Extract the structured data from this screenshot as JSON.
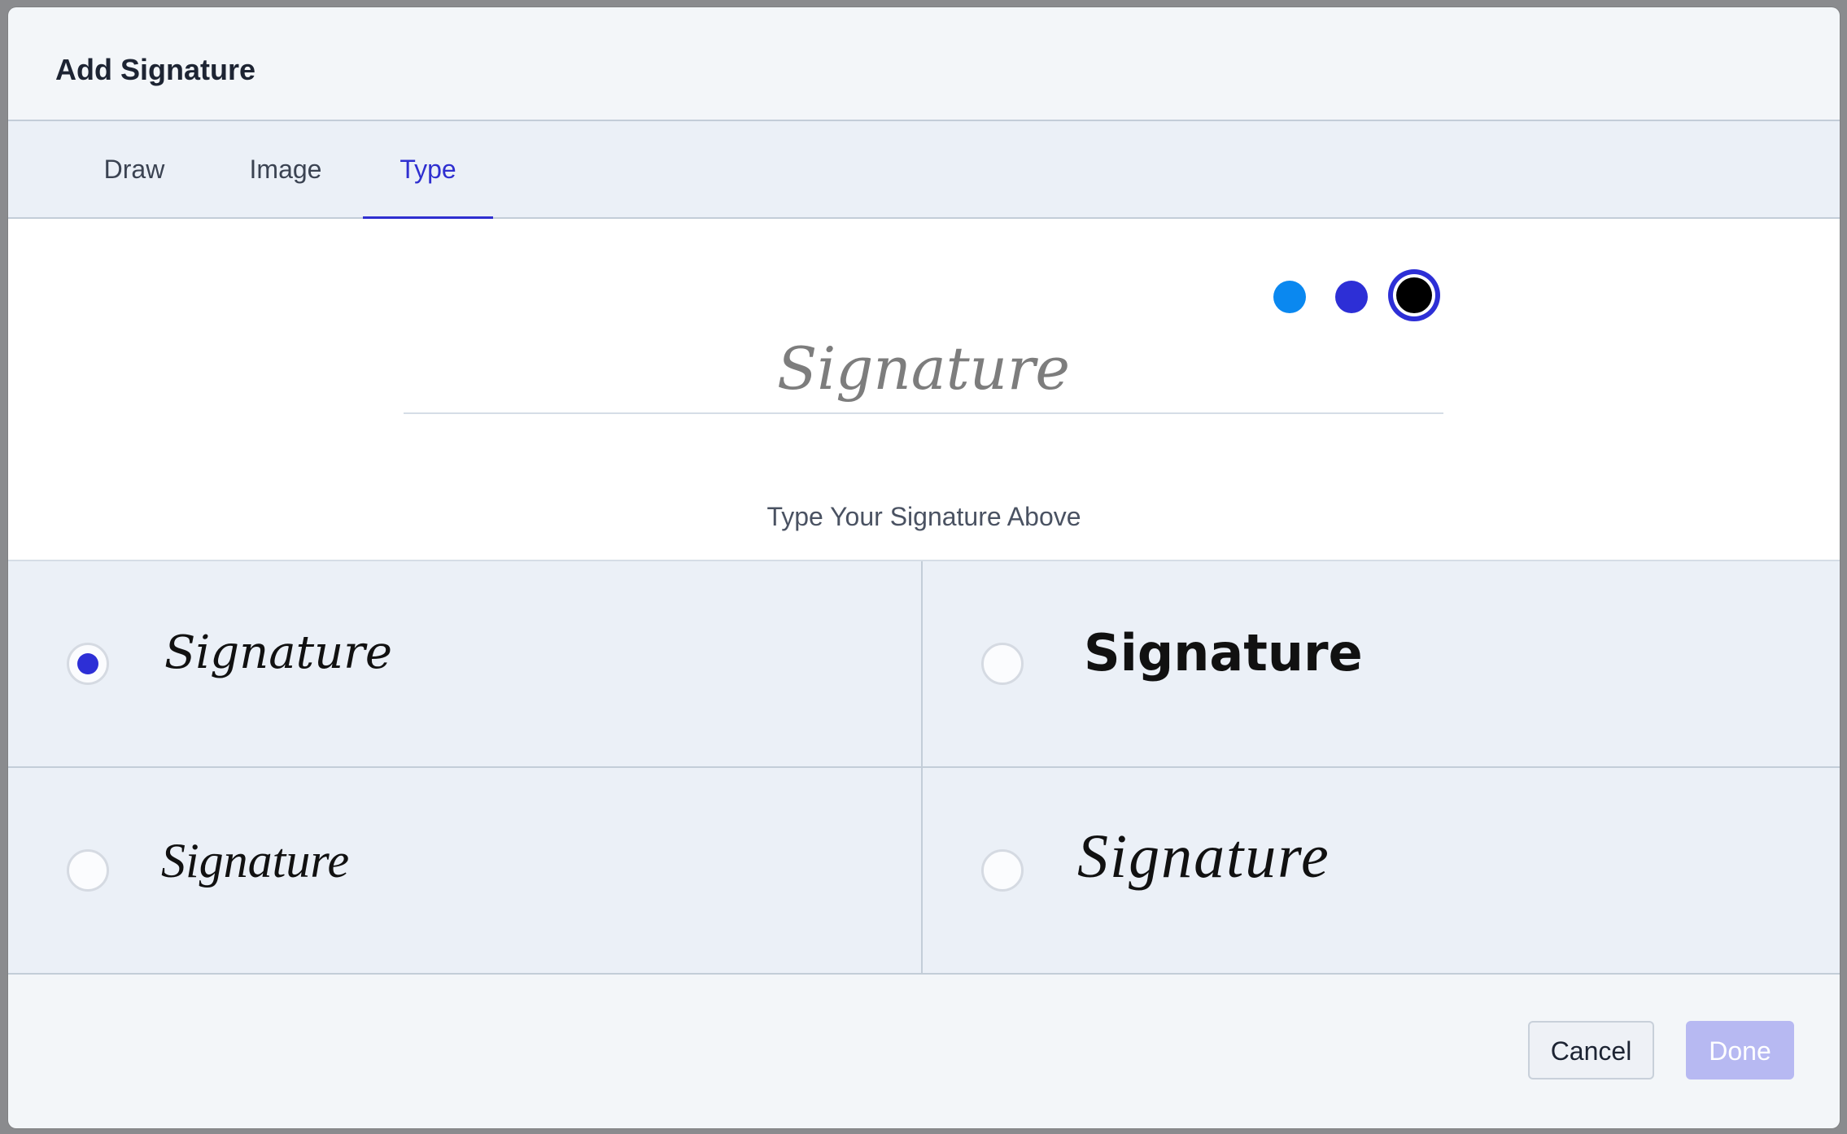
{
  "dialog": {
    "title": "Add Signature"
  },
  "tabs": [
    {
      "label": "Draw",
      "active": false
    },
    {
      "label": "Image",
      "active": false
    },
    {
      "label": "Type",
      "active": true
    }
  ],
  "colors": {
    "options": [
      "#0a88f0",
      "#2d2fd6",
      "#000000"
    ],
    "selected": "#000000",
    "accent": "#2d2fd6"
  },
  "signature": {
    "placeholder": "Signature",
    "value": "",
    "hint": "Type Your Signature Above"
  },
  "font_options": [
    {
      "label": "Signature",
      "selected": true
    },
    {
      "label": "Signature",
      "selected": false
    },
    {
      "label": "Signature",
      "selected": false
    },
    {
      "label": "Signature",
      "selected": false
    }
  ],
  "footer": {
    "cancel_label": "Cancel",
    "done_label": "Done",
    "done_enabled": false
  }
}
